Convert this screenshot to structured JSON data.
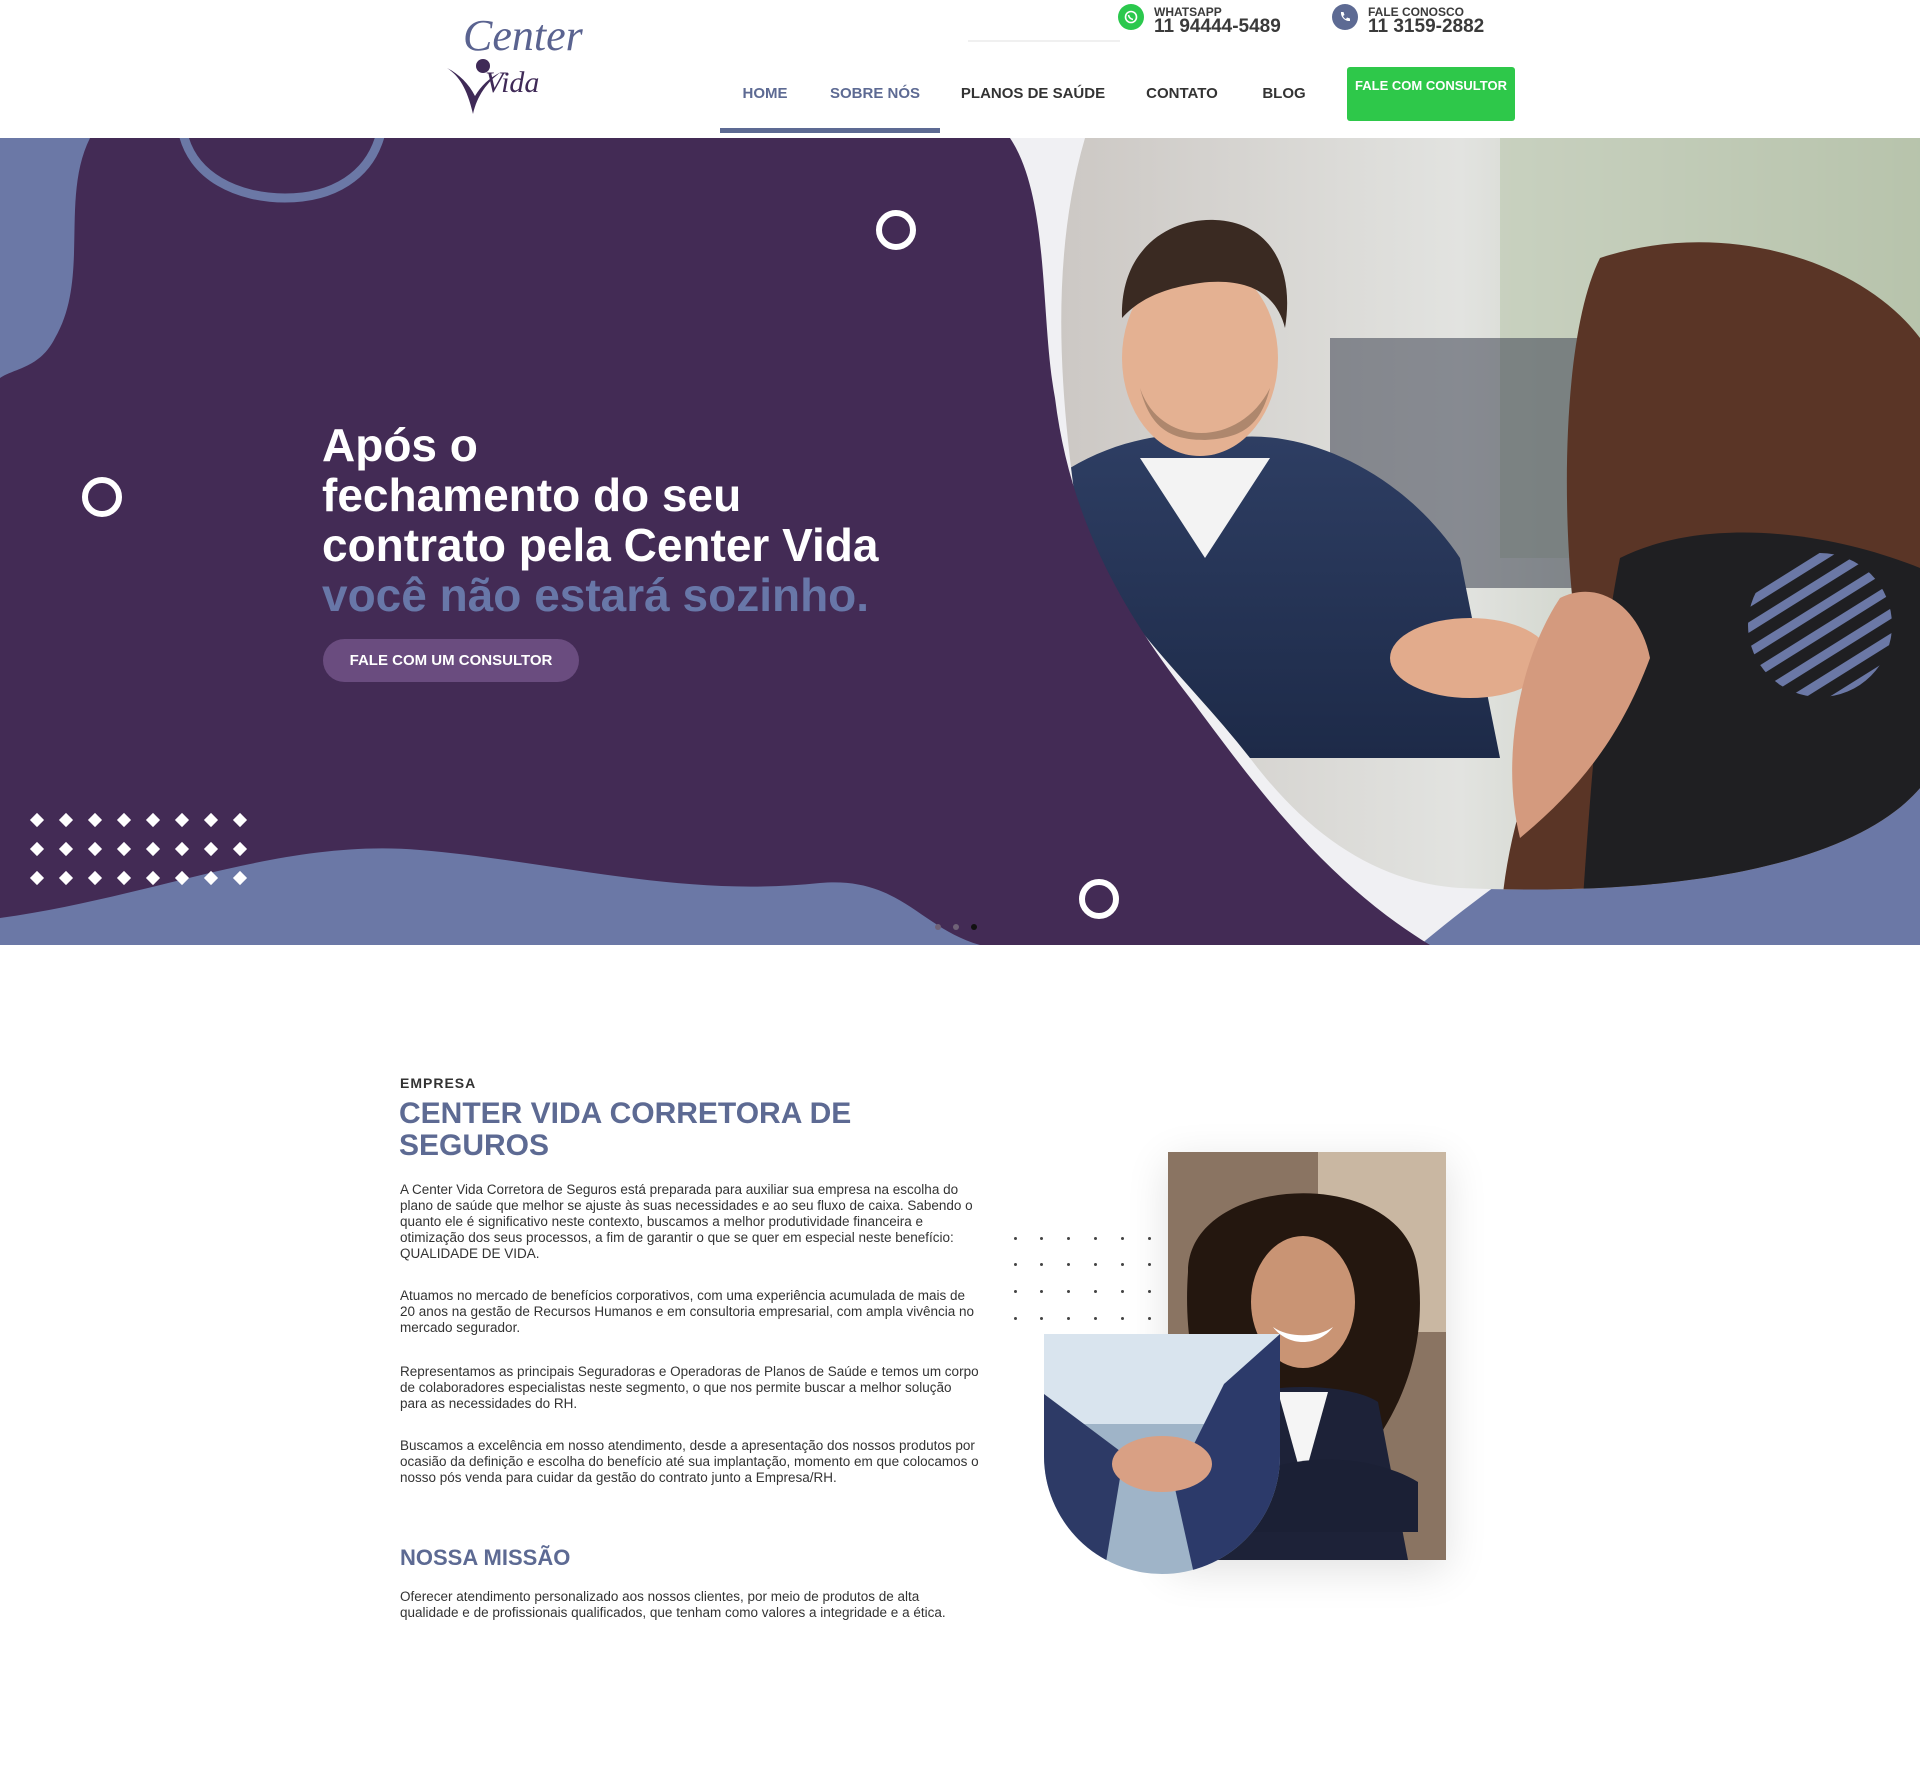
{
  "header": {
    "logo": {
      "line1": "Center",
      "line2": "Vida"
    },
    "contacts": [
      {
        "icon": "whatsapp-icon",
        "label": "WHATSAPP",
        "number": "11 94444-5489"
      },
      {
        "icon": "phone-icon",
        "label": "FALE CONOSCO",
        "number": "11 3159-2882"
      }
    ],
    "nav": [
      {
        "label": "HOME",
        "active": true
      },
      {
        "label": "SOBRE NÓS"
      },
      {
        "label": "PLANOS DE SAÚDE"
      },
      {
        "label": "CONTATO"
      },
      {
        "label": "BLOG"
      }
    ],
    "cta": "FALE COM CONSULTOR"
  },
  "hero": {
    "title_lines": [
      "Após o",
      "fechamento do seu",
      "contrato pela Center Vida"
    ],
    "title_highlight": "você não estará sozinho.",
    "button": "FALE COM UM CONSULTOR",
    "slides": 3,
    "active_slide": 3
  },
  "about": {
    "eyebrow": "EMPRESA",
    "title": "CENTER VIDA CORRETORA DE SEGUROS",
    "paragraphs": [
      "A Center Vida Corretora de Seguros está preparada para auxiliar sua empresa na escolha do plano de saúde que melhor se ajuste às suas necessidades e ao seu fluxo de caixa. Sabendo o quanto ele é significativo neste contexto, buscamos a melhor produtividade financeira e otimização dos seus processos, a fim de garantir o que se quer em especial neste benefício: QUALIDADE DE VIDA.",
      "Atuamos no mercado de benefícios corporativos, com uma experiência acumulada de mais de 20 anos na gestão de Recursos Humanos e em consultoria empresarial, com ampla vivência no mercado segurador.",
      "Representamos as principais Seguradoras e Operadoras de Planos de Saúde e temos um corpo de colaboradores especialistas neste segmento, o que nos permite buscar a melhor solução para as necessidades do RH.",
      "Buscamos a excelência em nosso atendimento, desde a apresentação dos nossos produtos por ocasião da definição e escolha do benefício até sua implantação, momento em que colocamos o nosso pós venda para cuidar da gestão do contrato junto a Empresa/RH."
    ],
    "mission_title": "NOSSA MISSÃO",
    "mission_text": "Oferecer atendimento personalizado aos nossos clientes, por meio de produtos de alta qualidade e de profissionais qualificados, que tenham como valores a integridade e a ética."
  },
  "colors": {
    "brand_purple": "#432b55",
    "brand_blue": "#5d6a93",
    "cta_green": "#2ec84a"
  }
}
